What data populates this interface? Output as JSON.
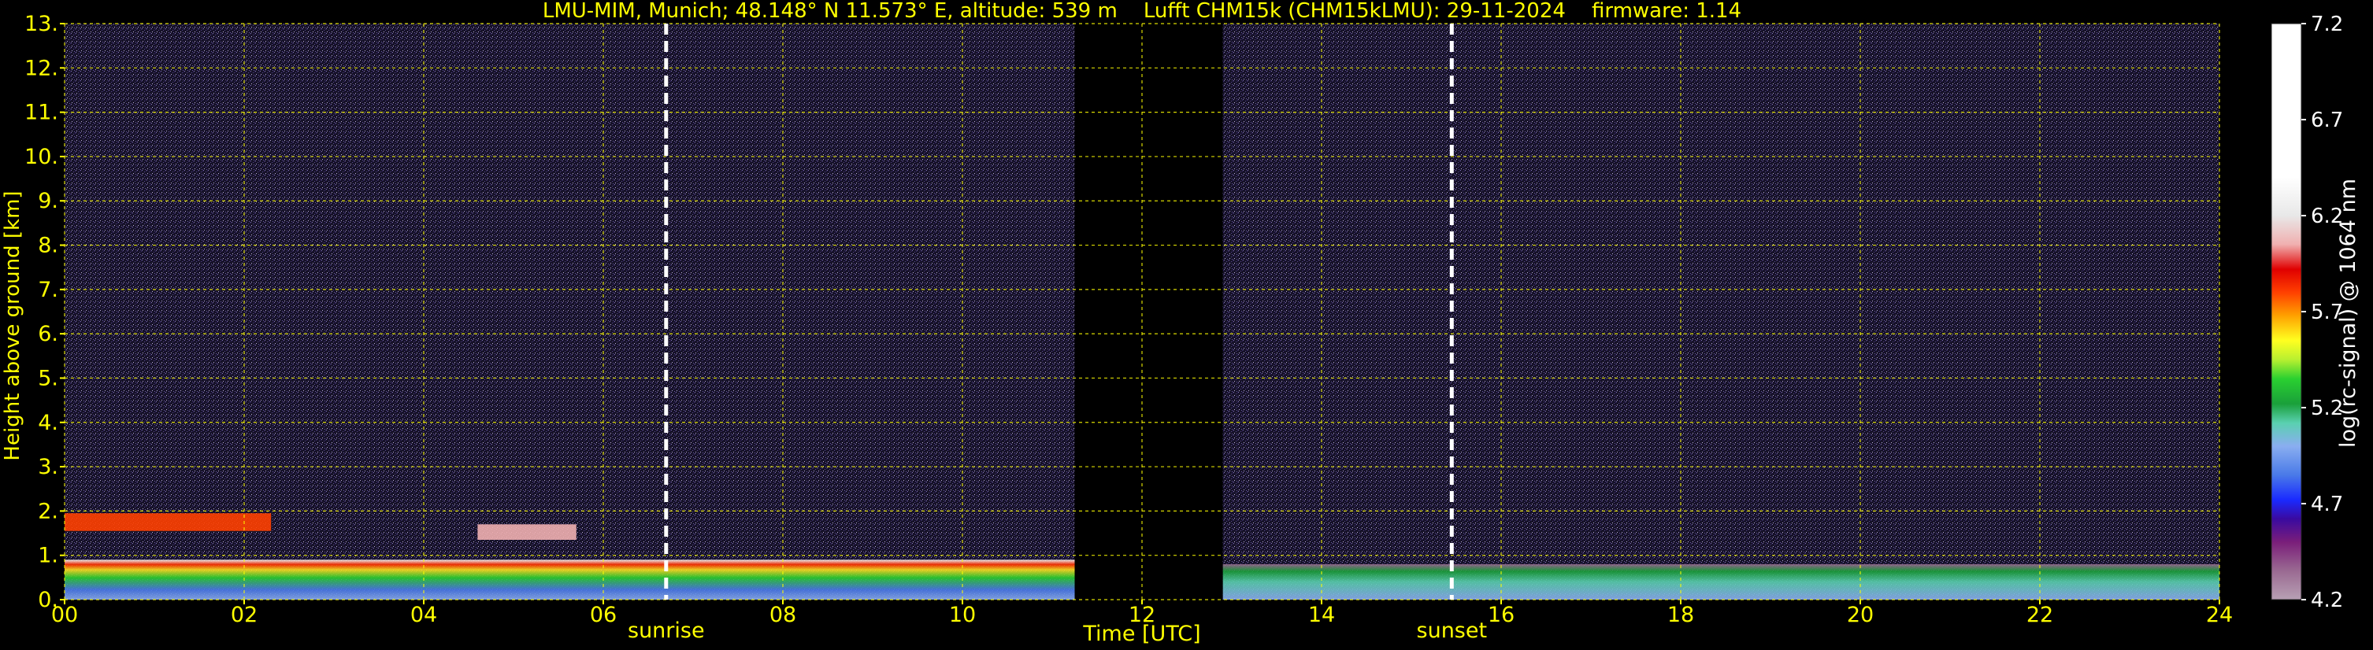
{
  "chart_data": {
    "type": "heatmap",
    "title": "LMU-MIM, Munich; 48.148° N 11.573° E, altitude: 539 m    Lufft CHM15k (CHM15kLMU): 29-11-2024    firmware: 1.14",
    "xlabel": "Time [UTC]",
    "ylabel": "Height above ground [km]",
    "xlim": [
      0,
      24
    ],
    "ylim": [
      0,
      13
    ],
    "x_ticks": [
      0,
      2,
      4,
      6,
      8,
      10,
      12,
      14,
      16,
      18,
      20,
      22,
      24
    ],
    "x_tick_labels": [
      "00",
      "02",
      "04",
      "06",
      "08",
      "10",
      "12",
      "14",
      "16",
      "18",
      "20",
      "22",
      "24"
    ],
    "y_ticks": [
      0,
      1,
      2,
      3,
      4,
      5,
      6,
      7,
      8,
      9,
      10,
      11,
      12,
      13
    ],
    "y_tick_labels": [
      "0.",
      "1.",
      "2.",
      "3.",
      "4.",
      "5.",
      "6.",
      "7.",
      "8.",
      "9.",
      "10.",
      "11.",
      "12.",
      "13."
    ],
    "grid": true,
    "grid_color": "#ffff00",
    "axis_text_color": "#ffff00",
    "background_color": "#000000",
    "annotations": [
      {
        "label": "sunrise",
        "x": 6.7
      },
      {
        "label": "sunset",
        "x": 15.45
      }
    ],
    "colorbar": {
      "label": "log(rc-signal) @ 1064 nm",
      "min": 4.2,
      "max": 7.2,
      "ticks": [
        4.2,
        4.7,
        5.2,
        5.7,
        6.2,
        6.7,
        7.2
      ],
      "tick_labels": [
        "4.2",
        "4.7",
        "5.2",
        "5.7",
        "6.2",
        "6.7",
        "7.2"
      ],
      "stops": [
        {
          "v": 4.2,
          "color": "#b8a0b4"
        },
        {
          "v": 4.35,
          "color": "#9a6a92"
        },
        {
          "v": 4.5,
          "color": "#7a1e7a"
        },
        {
          "v": 4.62,
          "color": "#3a0aa0"
        },
        {
          "v": 4.72,
          "color": "#1a2aff"
        },
        {
          "v": 4.85,
          "color": "#4a7ae8"
        },
        {
          "v": 5.0,
          "color": "#8aaef0"
        },
        {
          "v": 5.12,
          "color": "#5ad0b0"
        },
        {
          "v": 5.22,
          "color": "#1aa03a"
        },
        {
          "v": 5.35,
          "color": "#2ad030"
        },
        {
          "v": 5.45,
          "color": "#b8f030"
        },
        {
          "v": 5.55,
          "color": "#ffff20"
        },
        {
          "v": 5.68,
          "color": "#ffa000"
        },
        {
          "v": 5.8,
          "color": "#ff4000"
        },
        {
          "v": 5.92,
          "color": "#e00000"
        },
        {
          "v": 6.05,
          "color": "#f0b0b0"
        },
        {
          "v": 6.2,
          "color": "#e8e8e8"
        },
        {
          "v": 6.4,
          "color": "#ffffff"
        },
        {
          "v": 7.2,
          "color": "#ffffff"
        }
      ]
    },
    "data_gaps": [
      [
        11.25,
        12.9
      ]
    ],
    "layers": [
      {
        "name": "cloud top layer",
        "x": [
          0.0,
          2.3
        ],
        "y": [
          1.55,
          1.95
        ],
        "value": 5.9
      },
      {
        "name": "cloud",
        "x": [
          4.6,
          5.7
        ],
        "y": [
          1.35,
          1.7
        ],
        "value": 6.1
      },
      {
        "name": "boundary layer",
        "x": [
          0.0,
          11.25
        ],
        "y": [
          0.0,
          0.9
        ],
        "value": 5.3
      },
      {
        "name": "boundary layer",
        "x": [
          12.9,
          24.0
        ],
        "y": [
          0.0,
          0.8
        ],
        "value": 4.9
      }
    ]
  }
}
